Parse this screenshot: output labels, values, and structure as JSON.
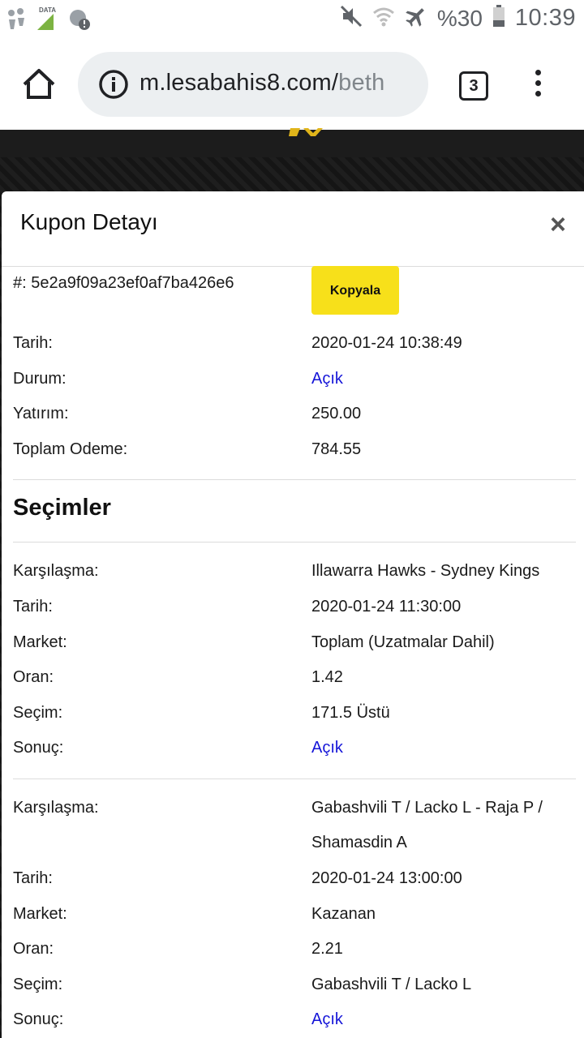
{
  "status_bar": {
    "data_label": "DATA",
    "battery": "%30",
    "time": "10:39"
  },
  "browser": {
    "url_main": "m.lesabahis8.com/",
    "url_tail": "beth",
    "tab_count": "3"
  },
  "modal": {
    "title": "Kupon Detayı",
    "close": "×",
    "coupon": {
      "id_label": "#: 5e2a9f09a23ef0af7ba426e6",
      "copy_label": "Kopyala",
      "rows": [
        {
          "label": "Tarih:",
          "value": "2020-01-24 10:38:49"
        },
        {
          "label": "Durum:",
          "value": "Açık"
        },
        {
          "label": "Yatırım:",
          "value": "250.00"
        },
        {
          "label": "Toplam Odeme:",
          "value": "784.55"
        }
      ]
    },
    "selections_title": "Seçimler",
    "selections": [
      {
        "rows": [
          {
            "label": "Karşılaşma:",
            "value": "Illawarra Hawks - Sydney Kings"
          },
          {
            "label": "Tarih:",
            "value": "2020-01-24 11:30:00"
          },
          {
            "label": "Market:",
            "value": "Toplam (Uzatmalar Dahil)"
          },
          {
            "label": "Oran:",
            "value": "1.42"
          },
          {
            "label": "Seçim:",
            "value": "171.5 Üstü"
          },
          {
            "label": "Sonuç:",
            "value": "Açık"
          }
        ]
      },
      {
        "rows": [
          {
            "label": "Karşılaşma:",
            "value": "Gabashvili T / Lacko L - Raja P / Shamasdin A"
          },
          {
            "label": "Tarih:",
            "value": "2020-01-24 13:00:00"
          },
          {
            "label": "Market:",
            "value": "Kazanan"
          },
          {
            "label": "Oran:",
            "value": "2.21"
          },
          {
            "label": "Seçim:",
            "value": "Gabashvili T / Lacko L"
          },
          {
            "label": "Sonuç:",
            "value": "Açık"
          }
        ]
      }
    ]
  },
  "colors": {
    "link": "#1515d8",
    "copy_button": "#f7e01a",
    "site_dark": "#1c1c1c"
  }
}
